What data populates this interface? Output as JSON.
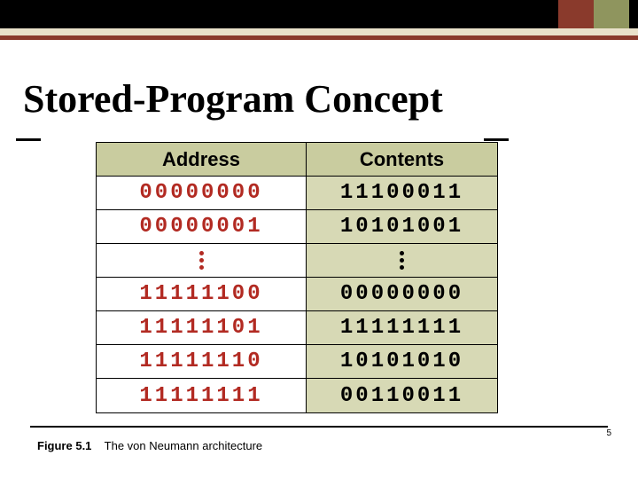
{
  "title": "Stored-Program Concept",
  "headers": {
    "address": "Address",
    "contents": "Contents"
  },
  "rows": [
    {
      "address": "00000000",
      "contents": "11100011"
    },
    {
      "address": "00000001",
      "contents": "10101001"
    },
    {
      "ellipsis": true
    },
    {
      "address": "11111100",
      "contents": "00000000"
    },
    {
      "address": "11111101",
      "contents": "11111111"
    },
    {
      "address": "11111110",
      "contents": "10101010"
    },
    {
      "address": "11111111",
      "contents": "00110011"
    }
  ],
  "caption": {
    "figure": "Figure 5.1",
    "text": "The von Neumann architecture"
  },
  "page_number": "5"
}
